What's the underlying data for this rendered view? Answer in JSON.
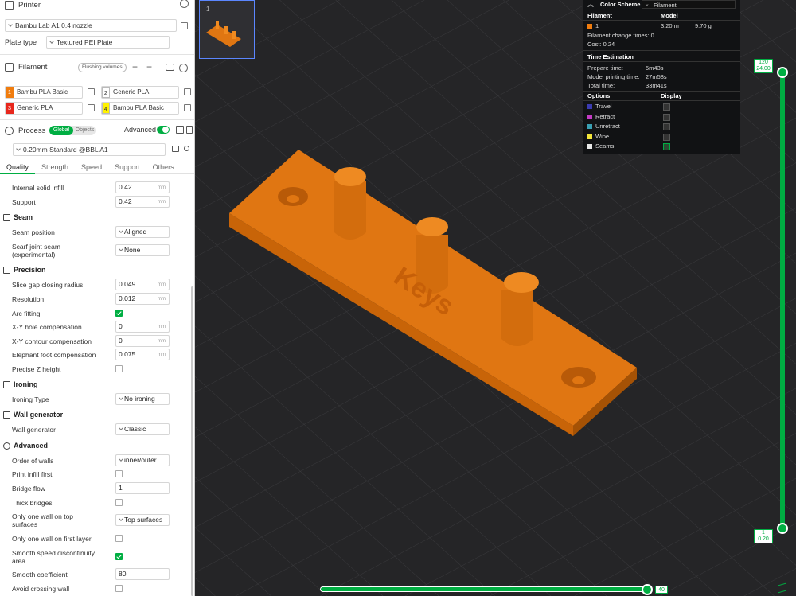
{
  "printer": {
    "title": "Printer",
    "model": "Bambu Lab A1 0.4 nozzle",
    "plate_label": "Plate type",
    "plate_value": "Textured PEI Plate"
  },
  "filament": {
    "title": "Filament",
    "flushing": "Flushing volumes",
    "plus": "+",
    "minus": "−",
    "items": [
      {
        "num": "1",
        "name": "Bambu PLA Basic",
        "color": "#f07c0e"
      },
      {
        "num": "2",
        "name": "Generic PLA",
        "color": "#ffffff"
      },
      {
        "num": "3",
        "name": "Generic PLA",
        "color": "#e8271c"
      },
      {
        "num": "4",
        "name": "Bambu PLA Basic",
        "color": "#fff200"
      }
    ]
  },
  "process": {
    "title": "Process",
    "global": "Global",
    "objects": "Objects",
    "advanced": "Advanced",
    "preset": "0.20mm Standard @BBL A1"
  },
  "tabs": [
    "Quality",
    "Strength",
    "Speed",
    "Support",
    "Others"
  ],
  "settings": {
    "internal_solid_infill": {
      "label": "Internal solid infill",
      "value": "0.42",
      "unit": "mm"
    },
    "support": {
      "label": "Support",
      "value": "0.42",
      "unit": "mm"
    },
    "seam_section": "Seam",
    "seam_position": {
      "label": "Seam position",
      "value": "Aligned"
    },
    "scarf": {
      "label1": "Scarf joint seam",
      "label2": "(experimental)",
      "value": "None"
    },
    "precision_section": "Precision",
    "slice_gap": {
      "label": "Slice gap closing radius",
      "value": "0.049",
      "unit": "mm"
    },
    "resolution": {
      "label": "Resolution",
      "value": "0.012",
      "unit": "mm"
    },
    "arc_fitting": {
      "label": "Arc fitting"
    },
    "xy_hole": {
      "label": "X-Y hole compensation",
      "value": "0",
      "unit": "mm"
    },
    "xy_contour": {
      "label": "X-Y contour compensation",
      "value": "0",
      "unit": "mm"
    },
    "elephant": {
      "label": "Elephant foot compensation",
      "value": "0.075",
      "unit": "mm"
    },
    "precise_z": {
      "label": "Precise Z height"
    },
    "ironing_section": "Ironing",
    "ironing_type": {
      "label": "Ironing Type",
      "value": "No ironing"
    },
    "wall_section": "Wall generator",
    "wall_generator": {
      "label": "Wall generator",
      "value": "Classic"
    },
    "advanced_section": "Advanced",
    "order_walls": {
      "label": "Order of walls",
      "value": "inner/outer"
    },
    "print_infill_first": {
      "label": "Print infill first"
    },
    "bridge_flow": {
      "label": "Bridge flow",
      "value": "1"
    },
    "thick_bridges": {
      "label": "Thick bridges"
    },
    "one_wall_top": {
      "label1": "Only one wall on top",
      "label2": "surfaces",
      "value": "Top surfaces"
    },
    "one_wall_first": {
      "label": "Only one wall on first layer"
    },
    "smooth_speed": {
      "label1": "Smooth speed discontinuity",
      "label2": "area"
    },
    "smooth_coef": {
      "label": "Smooth coefficient",
      "value": "80"
    },
    "avoid_crossing": {
      "label": "Avoid crossing wall"
    }
  },
  "thumb": {
    "plate_num": "1"
  },
  "legend": {
    "title": "Color Scheme",
    "scheme": "Filament",
    "col_filament": "Filament",
    "col_model": "Model",
    "row_num": "1",
    "row_len": "3.20 m",
    "row_weight": "9.70 g",
    "change_times": "Filament change times:  0",
    "cost": "Cost:  0.24",
    "time_title": "Time Estimation",
    "prepare_label": "Prepare time:",
    "prepare_val": "5m43s",
    "model_label": "Model printing time:",
    "model_val": "27m58s",
    "total_label": "Total time:",
    "total_val": "33m41s",
    "options": "Options",
    "display": "Display",
    "opts": [
      {
        "name": "Travel",
        "color": "#3b3bb0"
      },
      {
        "name": "Retract",
        "color": "#c43bc4"
      },
      {
        "name": "Unretract",
        "color": "#3aa0b3"
      },
      {
        "name": "Wipe",
        "color": "#f3e53a"
      },
      {
        "name": "Seams",
        "color": "#e8e8e8"
      }
    ]
  },
  "vslider": {
    "top_layer": "120",
    "top_height": "24.00",
    "bottom_layer": "1",
    "bottom_height": "0.20"
  },
  "hslider": {
    "value": "40"
  },
  "model_text": "Keys",
  "colors": {
    "accent": "#00ae42",
    "model": "#e07612"
  }
}
